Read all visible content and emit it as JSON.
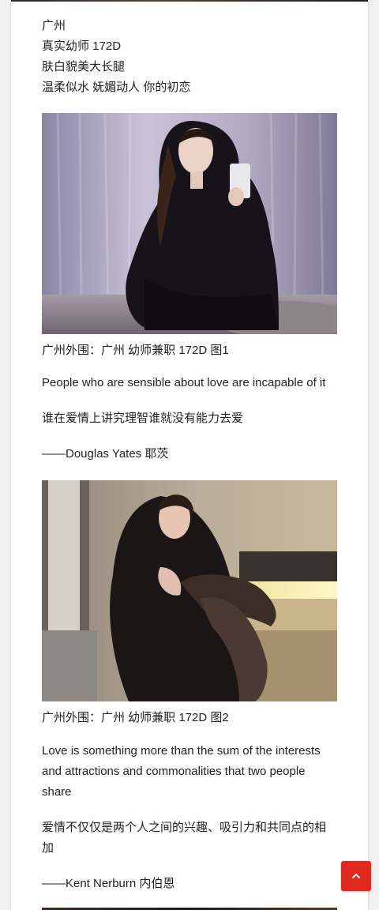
{
  "intro": {
    "lines": [
      "广州",
      "真实幼师 172D",
      "肤白貌美大长腿",
      "温柔似水 妩媚动人 你的初恋"
    ]
  },
  "photo1": {
    "caption": "广州外围：广州 幼师兼职 172D 图1",
    "quote_en": "People who are sensible about love are incapable of it",
    "quote_cn": "谁在爱情上讲究理智谁就没有能力去爱",
    "author": "——Douglas Yates 耶茨"
  },
  "photo2": {
    "caption": "广州外围：广州 幼师兼职 172D 图2",
    "quote_en": "Love is something more than the sum of the interests and attractions and commonalities that two people share",
    "quote_cn": "爱情不仅仅是两个人之间的兴趣、吸引力和共同点的相加",
    "author": "——Kent Nerburn 内伯恩"
  },
  "back_to_top": {
    "icon": "chevron-up-icon",
    "color": "#e0281e"
  }
}
